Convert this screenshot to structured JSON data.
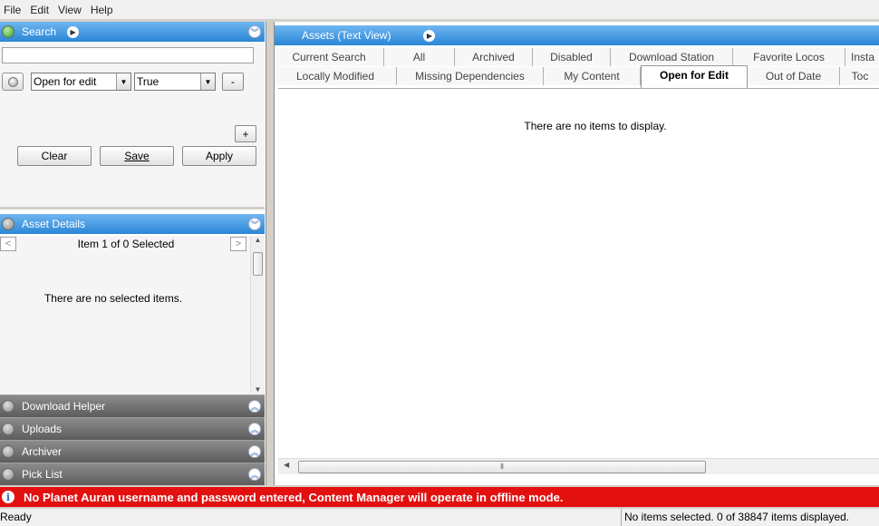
{
  "menu": [
    "File",
    "Edit",
    "View",
    "Help"
  ],
  "search_panel": {
    "title": "Search",
    "input_value": "",
    "filter_field": "Open for edit",
    "filter_value": "True",
    "remove_label": "-",
    "add_label": "+",
    "clear_label": "Clear",
    "save_label": "Save",
    "apply_label": "Apply"
  },
  "details_panel": {
    "title": "Asset Details",
    "prev_label": "<",
    "next_label": ">",
    "selection_label": "Item 1 of 0 Selected",
    "empty_message": "There are no selected items."
  },
  "collapsed_panels": [
    "Download Helper",
    "Uploads",
    "Archiver",
    "Pick List"
  ],
  "assets_view": {
    "title": "Assets (Text View)",
    "tabs_row1": [
      "Current Search",
      "All",
      "Archived",
      "Disabled",
      "Download Station",
      "Favorite Locos",
      "Insta"
    ],
    "tabs_row2": [
      "Locally Modified",
      "Missing Dependencies",
      "My Content",
      "Open for Edit",
      "Out of Date",
      "Toc"
    ],
    "active_tab": "Open for Edit",
    "empty_message": "There are no items to display."
  },
  "warning_message": "No Planet Auran username and password entered, Content Manager will operate in offline mode.",
  "status": {
    "left": "Ready",
    "right": "No items selected. 0 of 38847 items displayed."
  },
  "colors": {
    "header_blue": "#2a86d6",
    "warning_red": "#e31010"
  }
}
